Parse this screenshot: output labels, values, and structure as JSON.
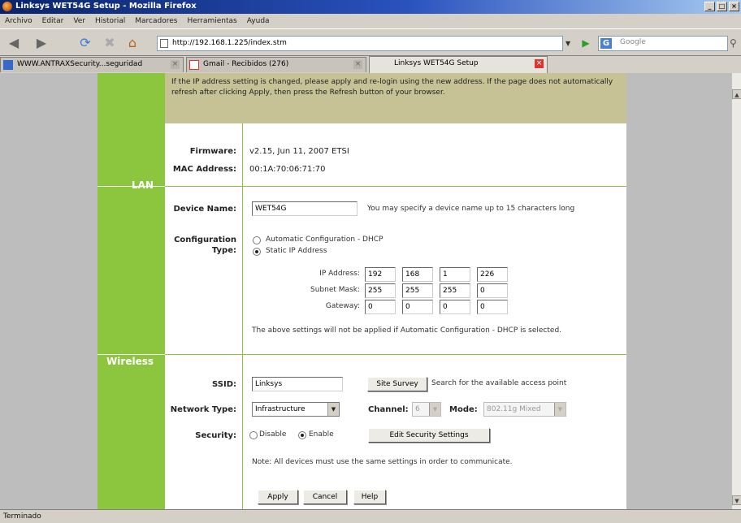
{
  "window": {
    "title": "Linksys WET54G Setup - Mozilla Firefox"
  },
  "menu": {
    "items": [
      "Archivo",
      "Editar",
      "Ver",
      "Historial",
      "Marcadores",
      "Herramientas",
      "Ayuda"
    ]
  },
  "nav": {
    "url": "http://192.168.1.225/index.stm",
    "search_placeholder": "Google"
  },
  "tabs": [
    {
      "label": "WWW.ANTRAXSecurity...seguridad"
    },
    {
      "label": "Gmail - Recibidos (276)"
    },
    {
      "label": "Linksys WET54G Setup"
    }
  ],
  "banner": {
    "text": "If the IP address setting is changed, please apply and re-login using the new address. If the page does not automatically refresh after clicking Apply, then press the Refresh button of your browser."
  },
  "sections": {
    "lan": "LAN",
    "wireless": "Wireless"
  },
  "lan": {
    "firmware_label": "Firmware:",
    "firmware_value": "v2.15, Jun 11, 2007 ETSI",
    "mac_label": "MAC Address:",
    "mac_value": "00:1A:70:06:71:70",
    "device_name_label": "Device Name:",
    "device_name_value": "WET54G",
    "device_name_hint": "You may specify a device name up to 15 characters long",
    "config_label": "Configuration Type:",
    "config_option_dhcp": "Automatic Configuration - DHCP",
    "config_option_static": "Static IP Address",
    "ip_label": "IP Address:",
    "ip": [
      "192",
      "168",
      "1",
      "226"
    ],
    "mask_label": "Subnet Mask:",
    "mask": [
      "255",
      "255",
      "255",
      "0"
    ],
    "gateway_label": "Gateway:",
    "gateway": [
      "0",
      "0",
      "0",
      "0"
    ],
    "note": "The above settings will not be applied if Automatic Configuration - DHCP is selected."
  },
  "wireless": {
    "ssid_label": "SSID:",
    "ssid_value": "Linksys",
    "site_survey": "Site Survey",
    "site_survey_hint": "Search for the available access point",
    "network_type_label": "Network Type:",
    "network_type_value": "Infrastructure",
    "channel_label": "Channel:",
    "channel_value": "6",
    "mode_label": "Mode:",
    "mode_value": "802.11g Mixed",
    "security_label": "Security:",
    "security_disable": "Disable",
    "security_enable": "Enable",
    "edit_security": "Edit Security Settings",
    "note": "Note: All devices must use the same settings in order to communicate."
  },
  "actions": {
    "apply": "Apply",
    "cancel": "Cancel",
    "help": "Help"
  },
  "status": {
    "text": "Terminado"
  }
}
